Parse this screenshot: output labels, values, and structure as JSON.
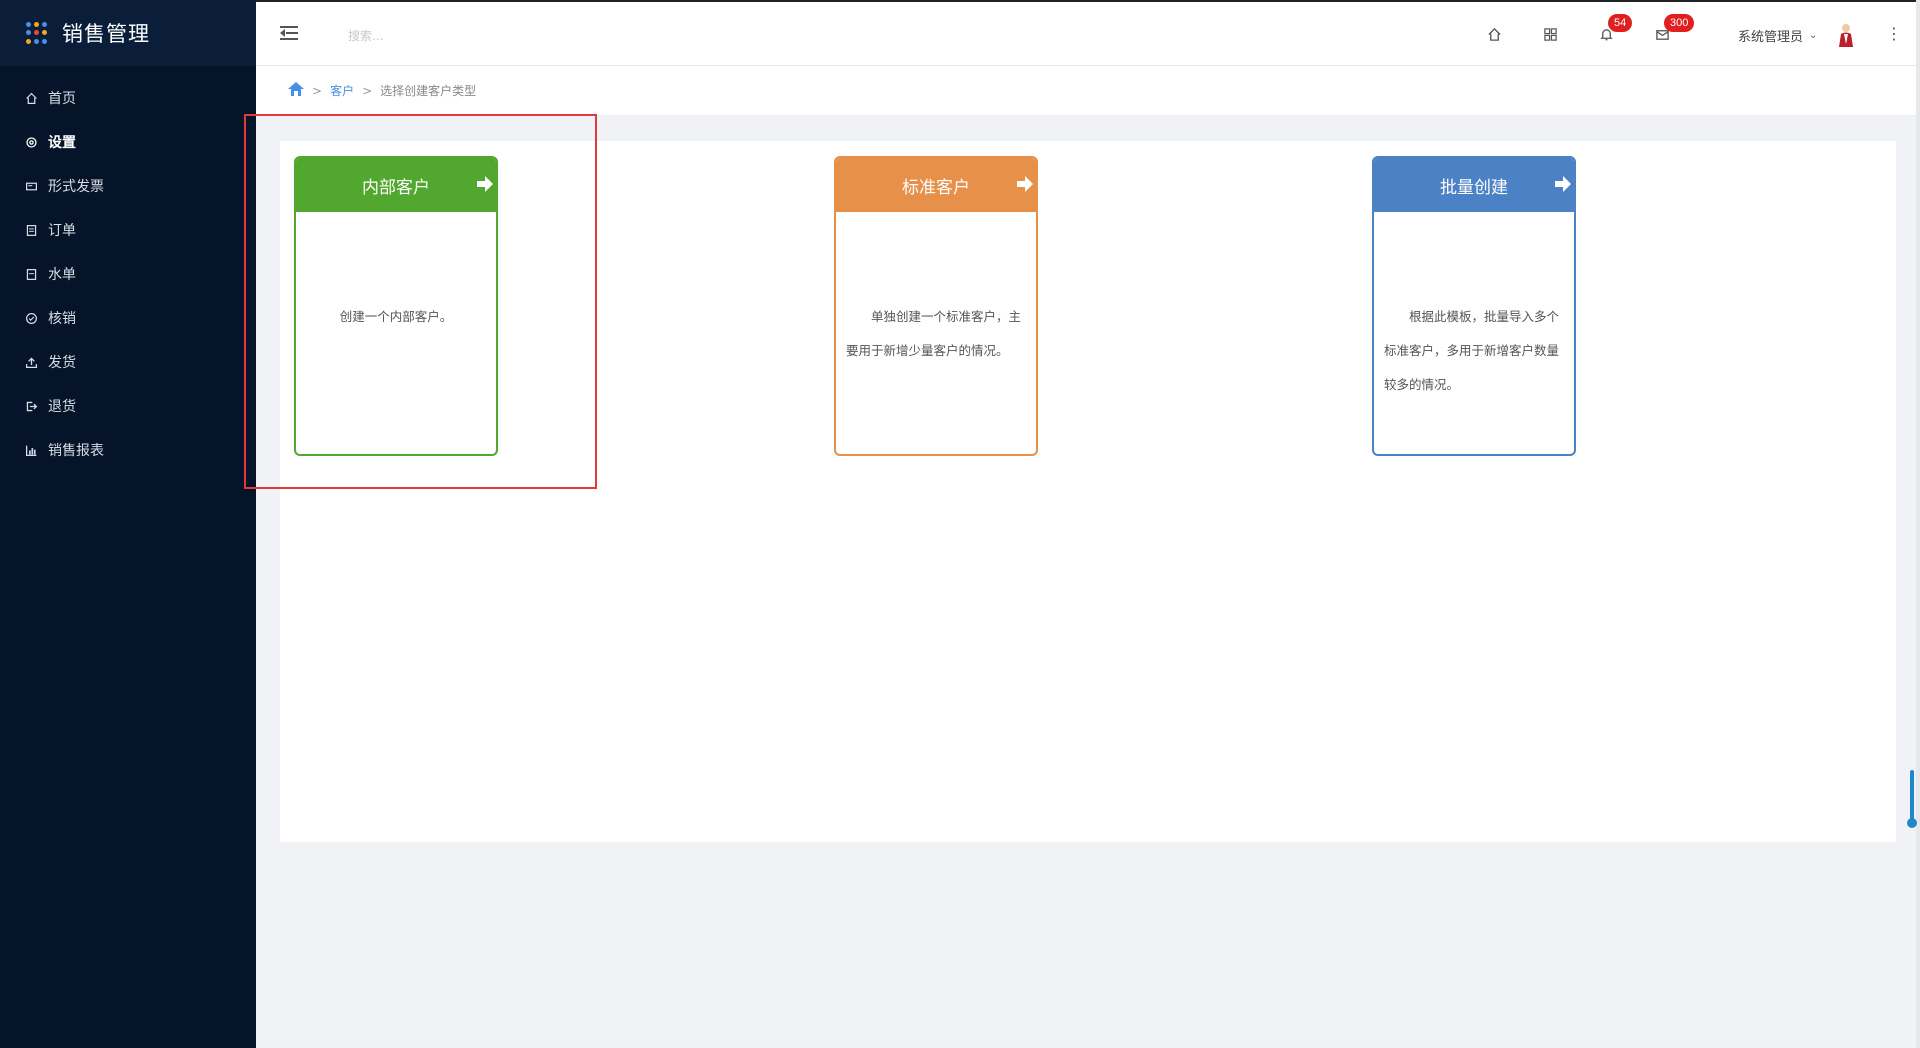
{
  "app": {
    "title": "销售管理",
    "colors": {
      "sidebar_bg": "#061429",
      "accent": "#4a8fe7",
      "badge": "#e02020",
      "highlight": "#e03a3a"
    }
  },
  "sidebar": {
    "items": [
      {
        "label": "首页",
        "icon": "home-icon"
      },
      {
        "label": "设置",
        "icon": "settings-icon",
        "active": true
      },
      {
        "label": "形式发票",
        "icon": "invoice-icon"
      },
      {
        "label": "订单",
        "icon": "order-icon"
      },
      {
        "label": "水单",
        "icon": "receipt-icon"
      },
      {
        "label": "核销",
        "icon": "check-circle-icon"
      },
      {
        "label": "发货",
        "icon": "upload-icon"
      },
      {
        "label": "退货",
        "icon": "return-icon"
      },
      {
        "label": "销售报表",
        "icon": "bar-chart-icon"
      }
    ]
  },
  "header": {
    "search_placeholder": "搜索...",
    "notifications_count": "54",
    "messages_count": "300",
    "user_name": "系统管理员"
  },
  "breadcrumb": {
    "home_icon": "home-icon",
    "parent": "客户",
    "current": "选择创建客户类型",
    "separator": ">"
  },
  "cards": [
    {
      "title": "内部客户",
      "desc": "创建一个内部客户。",
      "color": "#52a82e"
    },
    {
      "title": "标准客户",
      "desc": "单独创建一个标准客户，主要用于新增少量客户的情况。",
      "color": "#e6904a"
    },
    {
      "title": "批量创建",
      "desc": "根据此模板，批量导入多个标准客户，多用于新增客户数量较多的情况。",
      "color": "#4a82c5"
    }
  ]
}
